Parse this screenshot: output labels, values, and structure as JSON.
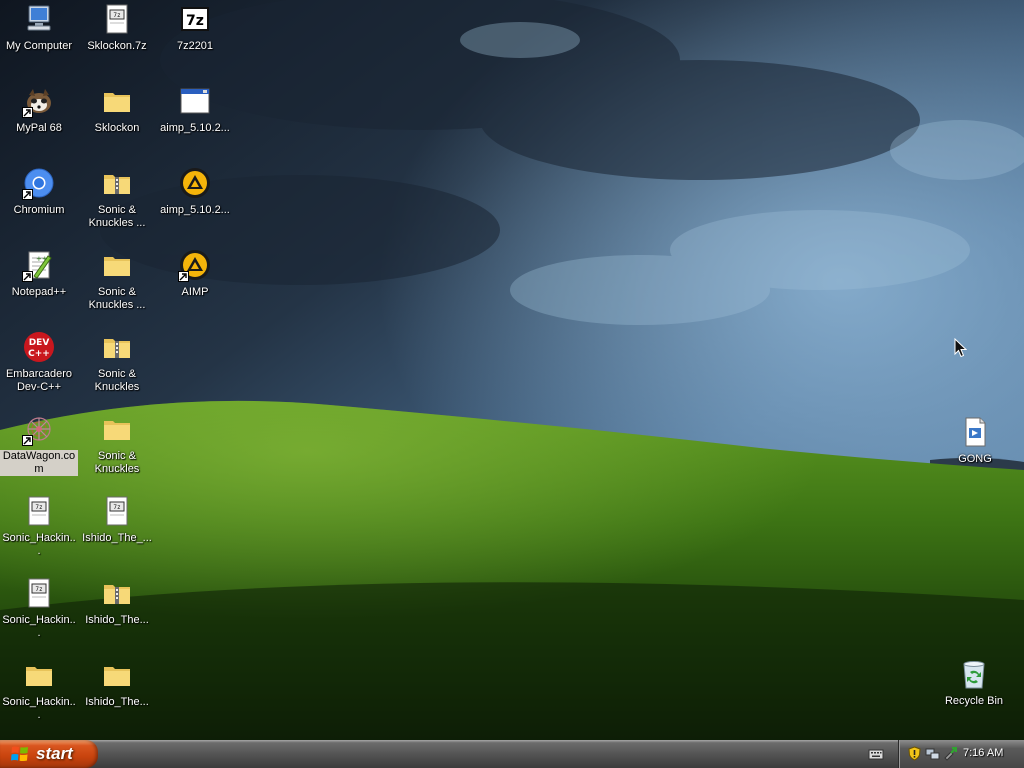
{
  "desktop": {
    "icons": [
      {
        "label": "My Computer",
        "icon": "my-computer-icon"
      },
      {
        "label": "Sklockon.7z",
        "icon": "archive-file-icon"
      },
      {
        "label": "7z2201",
        "icon": "seven-zip-icon"
      },
      {
        "label": "MyPal 68",
        "icon": "mypal-browser-icon"
      },
      {
        "label": "Sklockon",
        "icon": "folder-icon"
      },
      {
        "label": "aimp_5.10.2...",
        "icon": "installer-window-icon"
      },
      {
        "label": "Chromium",
        "icon": "chromium-icon"
      },
      {
        "label": "Sonic & Knuckles ...",
        "icon": "zip-folder-icon"
      },
      {
        "label": "aimp_5.10.2...",
        "icon": "aimp-icon"
      },
      {
        "label": "Notepad++",
        "icon": "notepad-plus-plus-icon"
      },
      {
        "label": "Sonic & Knuckles ...",
        "icon": "folder-icon"
      },
      {
        "label": "AIMP",
        "icon": "aimp-icon"
      },
      {
        "label": "Embarcadero Dev-C++",
        "icon": "dev-cpp-icon"
      },
      {
        "label": "Sonic & Knuckles",
        "icon": "zip-folder-icon"
      },
      {
        "label": "DataWagon.com",
        "icon": "datawagon-icon"
      },
      {
        "label": "Sonic & Knuckles",
        "icon": "folder-icon"
      },
      {
        "label": "Sonic_Hackin...",
        "icon": "archive-file-icon"
      },
      {
        "label": "Ishido_The_...",
        "icon": "archive-file-icon"
      },
      {
        "label": "Sonic_Hackin...",
        "icon": "archive-file-icon"
      },
      {
        "label": "Ishido_The...",
        "icon": "zip-folder-icon"
      },
      {
        "label": "Sonic_Hackin...",
        "icon": "folder-icon"
      },
      {
        "label": "Ishido_The...",
        "icon": "folder-icon"
      },
      {
        "label": "GONG",
        "icon": "media-file-icon"
      },
      {
        "label": "Recycle Bin",
        "icon": "recycle-bin-icon"
      }
    ]
  },
  "taskbar": {
    "start_label": "start",
    "clock": "7:16 AM",
    "tray_icons": [
      "security-shield-icon",
      "network-icon",
      "safely-remove-icon"
    ]
  },
  "colors": {
    "taskbar": "#545454",
    "start_button": "#c8430d",
    "selection": "#d4d0c8"
  }
}
